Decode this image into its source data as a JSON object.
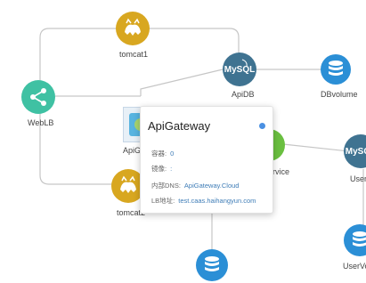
{
  "colors": {
    "tomcat": "#d8a720",
    "mysql": "#3f7391",
    "db": "#2b8fd6",
    "weblb": "#3fc1a3",
    "service": "#6abf40",
    "link": "#c6c6c6",
    "accent": "#3f7db7",
    "status_dot": "#4a90e2"
  },
  "nodes": {
    "tomcat1": {
      "label": "tomcat1",
      "icon": "tomcat-icon"
    },
    "tomcat2": {
      "label": "tomcat2",
      "icon": "tomcat-icon"
    },
    "weblb": {
      "label": "WebLB",
      "icon": "share-icon"
    },
    "apidb": {
      "label": "ApiDB",
      "icon": "mysql-icon"
    },
    "dbvolume": {
      "label": "DBvolume",
      "icon": "database-icon"
    },
    "apigateway": {
      "label": "ApiGa",
      "icon": "gateway-icon"
    },
    "service": {
      "label": "ervice",
      "icon": "service-icon"
    },
    "userdb": {
      "label": "UserD",
      "icon": "mysql-icon"
    },
    "uservol": {
      "label": "UserVol",
      "icon": "database-icon"
    },
    "bottomdb": {
      "label": "",
      "icon": "database-icon"
    }
  },
  "popup": {
    "title": "ApiGateway",
    "rows": [
      {
        "key": "容器:",
        "value": "0"
      },
      {
        "key": "镜像:",
        "value": ":"
      },
      {
        "key": "内部DNS:",
        "value": "ApiGateway.Cloud"
      },
      {
        "key": "LB地址:",
        "value": "test.caas.haihangyun.com"
      }
    ]
  }
}
